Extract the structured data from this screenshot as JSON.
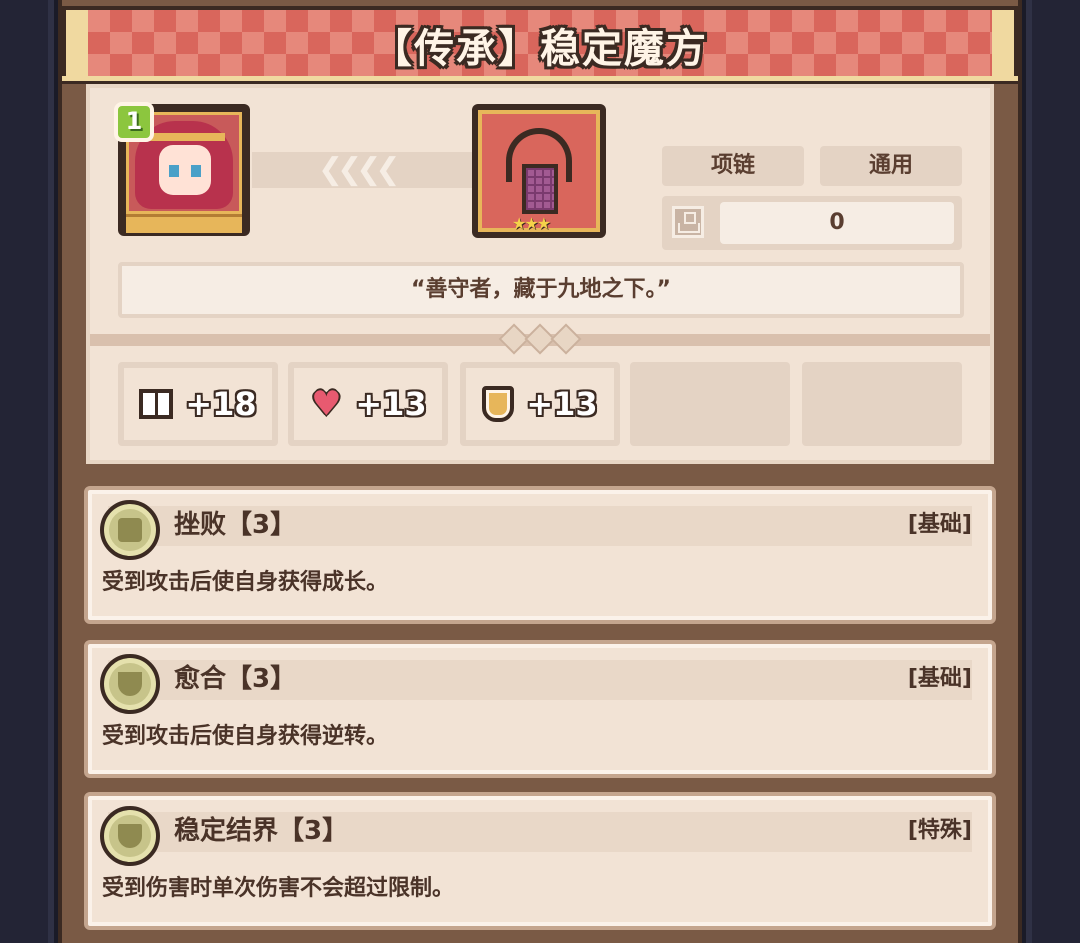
{
  "title": "【传承】稳定魔方",
  "hero": {
    "level": "1"
  },
  "item": {
    "tags": [
      "项链",
      "通用"
    ],
    "count": "0",
    "quote": "“善守者，藏于九地之下。”"
  },
  "stats": [
    {
      "icon": "book-icon",
      "value": "+18"
    },
    {
      "icon": "heart-icon",
      "value": "+13"
    },
    {
      "icon": "shield-icon",
      "value": "+13"
    }
  ],
  "skills": [
    {
      "name": "挫败【3】",
      "type": "[基础]",
      "desc": "受到攻击后使自身获得成长。",
      "icon": "skull-icon"
    },
    {
      "name": "愈合【3】",
      "type": "[基础]",
      "desc": "受到攻击后使自身获得逆转。",
      "icon": "cup-icon"
    },
    {
      "name": "稳定结界【3】",
      "type": "[特殊]",
      "desc": "受到伤害时单次伤害不会超过限制。",
      "icon": "shield-icon"
    }
  ],
  "colors": {
    "banner": "#d9665c",
    "panel": "#f2e3d5",
    "text": "#4a3328"
  }
}
